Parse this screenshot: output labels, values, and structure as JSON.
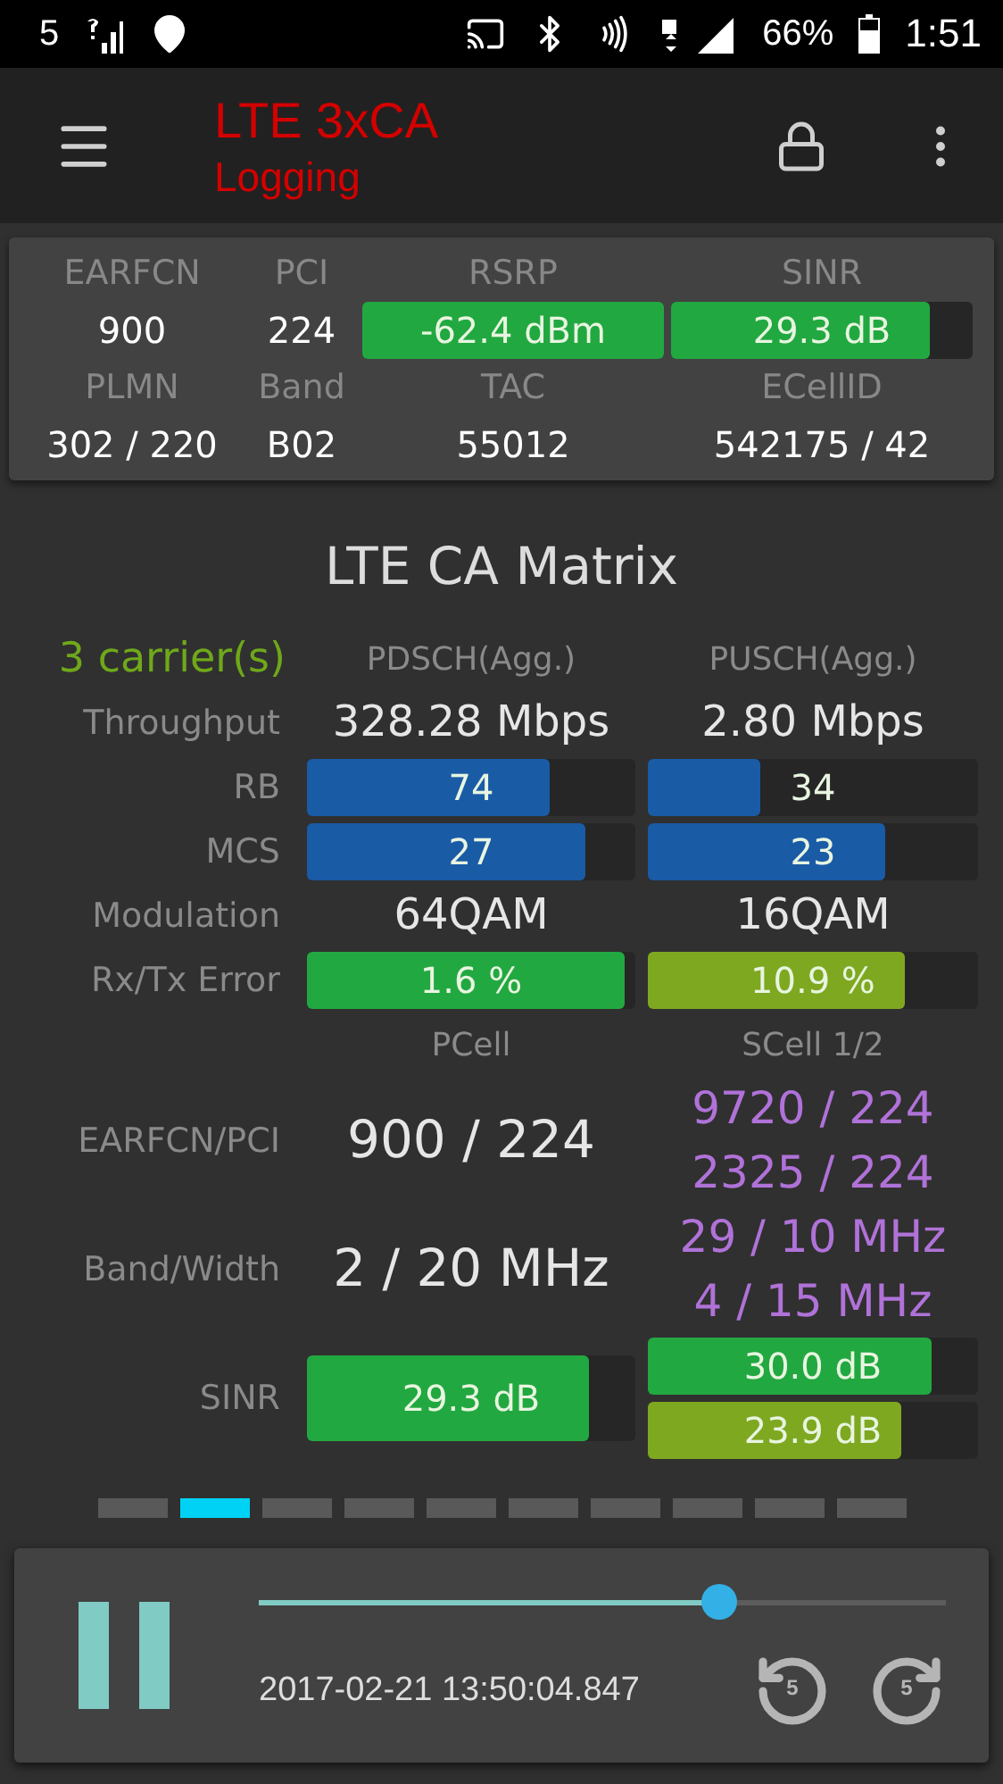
{
  "status_bar": {
    "notification": "5",
    "battery": "66%",
    "time": "1:51"
  },
  "app_bar": {
    "title": "LTE 3xCA",
    "subtitle": "Logging"
  },
  "serving_cell": {
    "rows": [
      {
        "cells": [
          {
            "kind": "label",
            "text": "EARFCN"
          },
          {
            "kind": "label",
            "text": "PCI"
          },
          {
            "kind": "label",
            "text": "RSRP"
          },
          {
            "kind": "label",
            "text": "SINR"
          }
        ]
      },
      {
        "cells": [
          {
            "kind": "text",
            "text": "900"
          },
          {
            "kind": "text",
            "text": "224"
          },
          {
            "kind": "bar",
            "text": "-62.4 dBm",
            "level": 1,
            "color": "#22a840"
          },
          {
            "kind": "bar",
            "text": "29.3 dB",
            "level": 0.86,
            "color": "#22a840"
          }
        ]
      },
      {
        "cells": [
          {
            "kind": "label",
            "text": "PLMN"
          },
          {
            "kind": "label",
            "text": "Band"
          },
          {
            "kind": "label",
            "text": "TAC"
          },
          {
            "kind": "label",
            "text": "ECellID"
          }
        ]
      },
      {
        "cells": [
          {
            "kind": "text",
            "text": "302 / 220"
          },
          {
            "kind": "text",
            "text": "B02"
          },
          {
            "kind": "text",
            "text": "55012"
          },
          {
            "kind": "text",
            "text": "542175 / 42"
          }
        ]
      }
    ]
  },
  "matrix": {
    "title": "LTE CA Matrix",
    "carriers": "3 carrier(s)",
    "columns": [
      "PDSCH(Agg.)",
      "PUSCH(Agg.)"
    ],
    "rows": [
      {
        "label": "Throughput",
        "kind": "text",
        "cells": [
          {
            "text": "328.28 Mbps"
          },
          {
            "text": "2.80 Mbps"
          }
        ]
      },
      {
        "label": "RB",
        "kind": "bar",
        "cells": [
          {
            "text": "74",
            "level": 0.74,
            "color": "#1a5ba6"
          },
          {
            "text": "34",
            "level": 0.34,
            "color": "#1a5ba6"
          }
        ]
      },
      {
        "label": "MCS",
        "kind": "bar",
        "cells": [
          {
            "text": "27",
            "level": 0.85,
            "color": "#1a5ba6"
          },
          {
            "text": "23",
            "level": 0.72,
            "color": "#1a5ba6"
          }
        ]
      },
      {
        "label": "Modulation",
        "kind": "text",
        "cells": [
          {
            "text": "64QAM"
          },
          {
            "text": "16QAM"
          }
        ]
      },
      {
        "label": "Rx/Tx Error",
        "kind": "bar",
        "cells": [
          {
            "text": "1.6 %",
            "level": 0.97,
            "color": "#22a840"
          },
          {
            "text": "10.9 %",
            "level": 0.78,
            "color": "#7fa821"
          }
        ]
      }
    ],
    "cell_columns": [
      "PCell",
      "SCell 1/2"
    ],
    "cell_rows": [
      {
        "label": "EARFCN/PCI",
        "kind": "text",
        "pcell": {
          "text": "900 / 224"
        },
        "scells": [
          {
            "text": "9720 / 224"
          },
          {
            "text": "2325 / 224"
          }
        ]
      },
      {
        "label": "Band/Width",
        "kind": "text",
        "pcell": {
          "text": "2 / 20 MHz"
        },
        "scells": [
          {
            "text": "29 / 10 MHz"
          },
          {
            "text": "4 / 15 MHz"
          }
        ]
      },
      {
        "label": "SINR",
        "kind": "bar",
        "pcell": {
          "text": "29.3 dB",
          "level": 0.86,
          "color": "#22a840"
        },
        "scells": [
          {
            "text": "30.0 dB",
            "level": 0.86,
            "color": "#22a840"
          },
          {
            "text": "23.9 dB",
            "level": 0.77,
            "color": "#7fa821"
          }
        ]
      }
    ]
  },
  "pager": [
    {
      "selected": false
    },
    {
      "selected": true
    },
    {
      "selected": false
    },
    {
      "selected": false
    },
    {
      "selected": false
    },
    {
      "selected": false
    },
    {
      "selected": false
    },
    {
      "selected": false
    },
    {
      "selected": false
    },
    {
      "selected": false
    }
  ],
  "player": {
    "playing": true,
    "level": 0.67,
    "timestamp": "2017-02-21 13:50:04.847",
    "rewind": "5",
    "forward": "5"
  }
}
